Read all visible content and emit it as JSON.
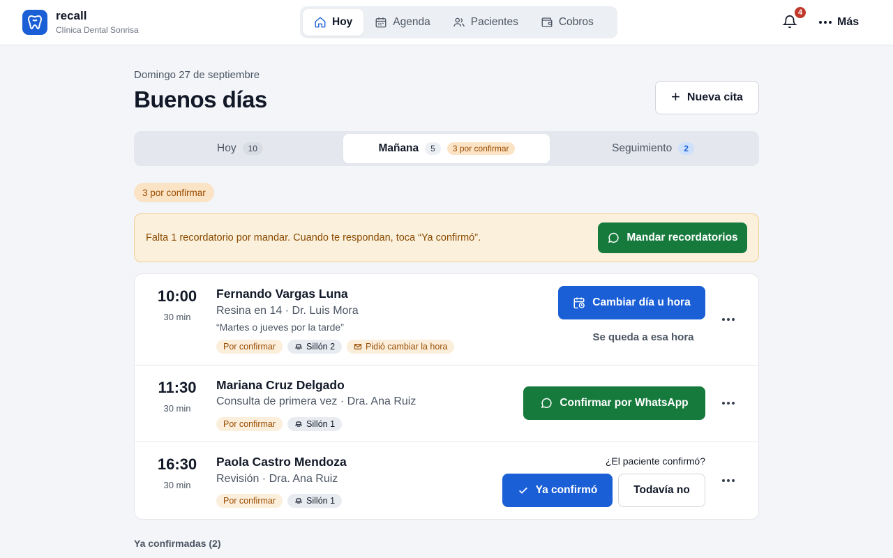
{
  "brand": {
    "name": "recall",
    "clinic": "Clínica Dental Sonrisa"
  },
  "nav": {
    "items": [
      {
        "label": "Hoy",
        "icon": "home-icon"
      },
      {
        "label": "Agenda",
        "icon": "calendar-icon"
      },
      {
        "label": "Pacientes",
        "icon": "users-icon"
      },
      {
        "label": "Cobros",
        "icon": "wallet-icon"
      }
    ],
    "active": "Hoy"
  },
  "header": {
    "notifications_count": "4",
    "more_label": "Más",
    "date": "Domingo 27 de septiembre",
    "greeting": "Buenos días",
    "new_appointment_label": "Nueva cita"
  },
  "tabs": {
    "today": {
      "label": "Hoy",
      "count": "10"
    },
    "tomorrow": {
      "label": "Mañana",
      "count": "5",
      "pending": "3 por confirmar"
    },
    "followup": {
      "label": "Seguimiento",
      "count": "2"
    }
  },
  "section": {
    "chip": "3 por confirmar"
  },
  "banner": {
    "text": "Falta 1 recordatorio por mandar. Cuando te respondan, toca “Ya confirmó”.",
    "button_label": "Mandar recordatorios"
  },
  "appointments": [
    {
      "time": "10:00",
      "duration": "30 min",
      "name": "Fernando Vargas Luna",
      "procedure": "Resina en 14 · Dr. Luis Mora",
      "note": "“Martes o jueves por la tarde”",
      "status": "Por confirmar",
      "chair": "Sillón 2",
      "request": "Pidió cambiar la hora",
      "primary_action": "Cambiar día u hora",
      "secondary_action": "Se queda a esa hora"
    },
    {
      "time": "11:30",
      "duration": "30 min",
      "name": "Mariana Cruz Delgado",
      "procedure": "Consulta de primera vez · Dra. Ana Ruiz",
      "status": "Por confirmar",
      "chair": "Sillón 1",
      "primary_action": "Confirmar por WhatsApp"
    },
    {
      "time": "16:30",
      "duration": "30 min",
      "name": "Paola Castro Mendoza",
      "procedure": "Revisión · Dra. Ana Ruiz",
      "status": "Por confirmar",
      "chair": "Sillón 1",
      "question": "¿El paciente confirmó?",
      "primary_action": "Ya confirmó",
      "secondary_action": "Todavía no"
    }
  ],
  "confirmed_section": {
    "label": "Ya confirmadas (2)"
  },
  "colors": {
    "brand_blue": "#1a5fd6",
    "whatsapp_green": "#157a3c",
    "pending_orange": "#9a4d00",
    "alert_red": "#c0392b"
  }
}
